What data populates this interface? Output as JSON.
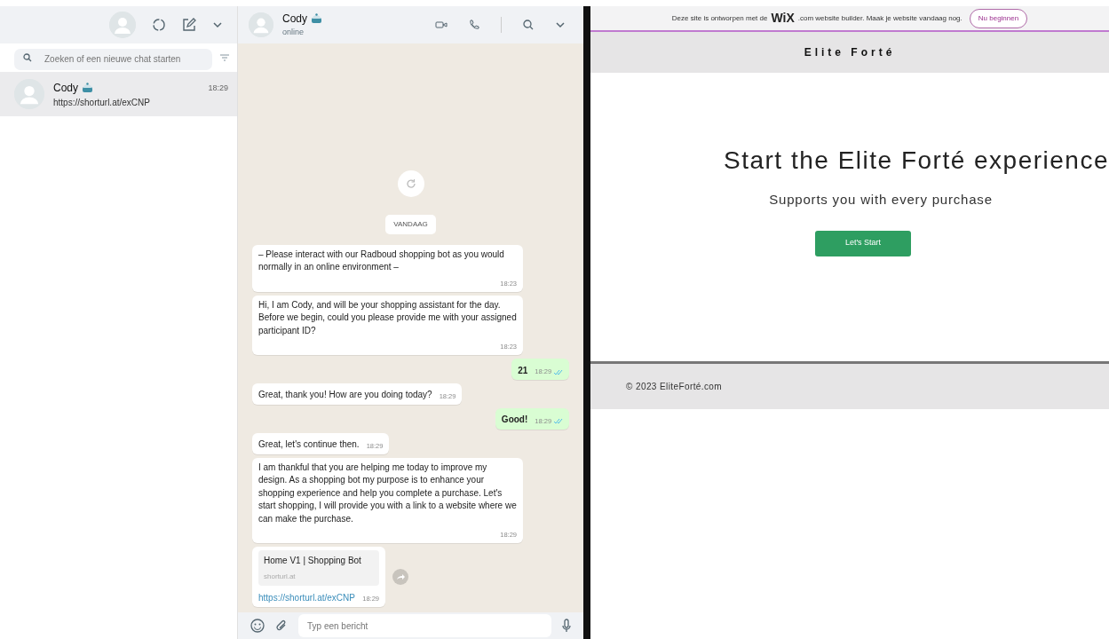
{
  "sidebar": {
    "search": {
      "placeholder": "Zoeken of een nieuwe chat starten"
    },
    "chats": [
      {
        "name": "Cody",
        "preview": "https://shorturl.at/exCNP",
        "time": "18:29",
        "selected": true
      }
    ]
  },
  "chat": {
    "header": {
      "name": "Cody",
      "status": "online"
    },
    "date_label": "VANDAAG",
    "messages": [
      {
        "kind": "in",
        "text": "– Please interact with our Radboud shopping bot as you would normally in an online environment –",
        "time": "18:23"
      },
      {
        "kind": "in",
        "text": "Hi, I am Cody, and will be your shopping assistant for the day. Before we begin, could you please provide me with your assigned participant ID?",
        "time": "18:23"
      },
      {
        "kind": "out",
        "text": "21",
        "time": "18:29",
        "read": true
      },
      {
        "kind": "in",
        "text": "Great, thank you! How are you doing today?",
        "time": "18:29"
      },
      {
        "kind": "out",
        "text": "Good!",
        "time": "18:29",
        "read": true
      },
      {
        "kind": "in",
        "text": "Great, let's continue then.",
        "time": "18:29"
      },
      {
        "kind": "in",
        "text": "I am thankful that you are helping me today to improve my design. As a shopping bot my purpose is to enhance your shopping experience and help you complete a purchase. Let's start shopping, I will provide you with a link to a website where we can make the purchase.",
        "time": "18:29"
      },
      {
        "kind": "link",
        "title": "Home V1 | Shopping Bot",
        "domain": "shorturl.at",
        "url": "https://shorturl.at/exCNP",
        "time": "18:29"
      }
    ],
    "composer": {
      "placeholder": "Typ een bericht"
    }
  },
  "website": {
    "banner": {
      "text_before": "Deze site is ontworpen met de",
      "logo": "WiX",
      "text_after": ".com website builder. Maak je website vandaag nog.",
      "button": "Nu beginnen"
    },
    "site_title": "Elite Forté",
    "hero": {
      "title": "Start the Elite Forté experience",
      "subtitle": "Supports you with every purchase",
      "button": "Let's Start"
    },
    "footer": "© 2023 EliteForté.com"
  }
}
